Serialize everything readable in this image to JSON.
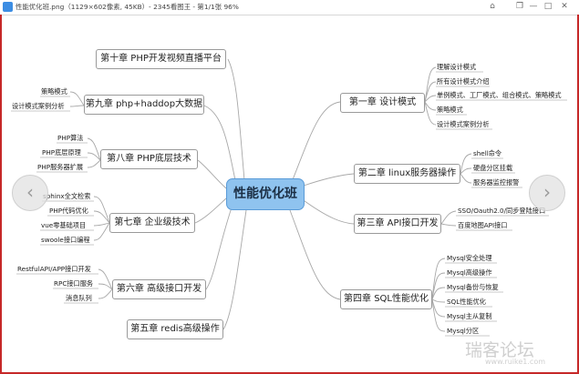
{
  "window": {
    "title": "性能优化班.png（1129×602像素, 45KB）- 2345看图王 - 第1/1张 96%",
    "controls": [
      "⌂",
      "❐",
      "—",
      "□",
      "✕"
    ]
  },
  "mindmap": {
    "center": "性能优化班",
    "ch1": {
      "label": "第一章  设计模式",
      "leaves": [
        "理解设计模式",
        "所有设计模式介绍",
        "单例模式、工厂模式、组合模式、策略模式",
        "策略模式",
        "设计模式案例分析"
      ]
    },
    "ch2": {
      "label": "第二章 linux服务器操作",
      "leaves": [
        "shell命令",
        "硬盘分区挂载",
        "服务器监控报警"
      ]
    },
    "ch3": {
      "label": "第三章 API接口开发",
      "leaves": [
        "SSO/Oauth2.0/同步登陆接口",
        "百度地图API接口"
      ]
    },
    "ch4": {
      "label": "第四章 SQL性能优化",
      "leaves": [
        "Mysql安全处理",
        "Mysql高级操作",
        "Mysql备份与恢复",
        "SQL性能优化",
        "Mysql主从复制",
        "Mysql分区"
      ]
    },
    "ch5": {
      "label": "第五章 redis高级操作"
    },
    "ch6": {
      "label": "第六章  高级接口开发",
      "leaves": [
        "RestfulAPI/APP接口开发",
        "RPC接口服务",
        "消息队列"
      ]
    },
    "ch7": {
      "label": "第七章  企业级技术",
      "leaves": [
        "sphinx全文检索",
        "PHP代码优化",
        "vue零基础项目",
        "swoole接口编程"
      ]
    },
    "ch8": {
      "label": "第八章  PHP底层技术",
      "leaves": [
        "PHP算法",
        "PHP底层原理",
        "PHP服务器扩展"
      ]
    },
    "ch9": {
      "label": "第九章  php+haddop大数据",
      "leaves": [
        "策略模式",
        "设计模式案例分析"
      ]
    },
    "ch10": {
      "label": "第十章  PHP开发视频直播平台"
    }
  },
  "navigation": {
    "prev_icon": "‹",
    "next_icon": "›"
  },
  "watermark": {
    "main": "瑞客论坛",
    "sub": "www.ruike1.com"
  }
}
